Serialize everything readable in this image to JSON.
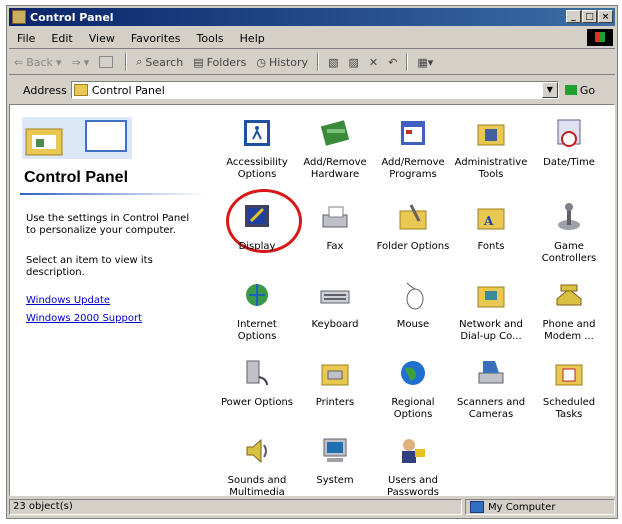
{
  "window": {
    "title": "Control Panel"
  },
  "menu": [
    "File",
    "Edit",
    "View",
    "Favorites",
    "Tools",
    "Help"
  ],
  "toolbar": {
    "back": "Back",
    "search": "Search",
    "folders": "Folders",
    "history": "History"
  },
  "address": {
    "label": "Address",
    "value": "Control Panel",
    "go": "Go"
  },
  "left": {
    "title": "Control Panel",
    "description": "Use the settings in Control Panel to personalize your computer.",
    "select_hint": "Select an item to view its description.",
    "links": [
      "Windows Update",
      "Windows 2000 Support"
    ]
  },
  "items": [
    {
      "label": "Accessibility Options",
      "icon": "accessibility-icon"
    },
    {
      "label": "Add/Remove Hardware",
      "icon": "hardware-icon"
    },
    {
      "label": "Add/Remove Programs",
      "icon": "programs-icon"
    },
    {
      "label": "Administrative Tools",
      "icon": "admin-tools-icon"
    },
    {
      "label": "Date/Time",
      "icon": "clock-icon"
    },
    {
      "label": "Display",
      "icon": "display-icon"
    },
    {
      "label": "Fax",
      "icon": "fax-icon"
    },
    {
      "label": "Folder Options",
      "icon": "folder-options-icon"
    },
    {
      "label": "Fonts",
      "icon": "fonts-icon"
    },
    {
      "label": "Game Controllers",
      "icon": "joystick-icon"
    },
    {
      "label": "Internet Options",
      "icon": "internet-icon"
    },
    {
      "label": "Keyboard",
      "icon": "keyboard-icon"
    },
    {
      "label": "Mouse",
      "icon": "mouse-icon"
    },
    {
      "label": "Network and Dial-up Co...",
      "icon": "network-icon"
    },
    {
      "label": "Phone and Modem ...",
      "icon": "phone-icon"
    },
    {
      "label": "Power Options",
      "icon": "power-icon"
    },
    {
      "label": "Printers",
      "icon": "printer-icon"
    },
    {
      "label": "Regional Options",
      "icon": "globe-icon"
    },
    {
      "label": "Scanners and Cameras",
      "icon": "scanner-icon"
    },
    {
      "label": "Scheduled Tasks",
      "icon": "calendar-icon"
    },
    {
      "label": "Sounds and Multimedia",
      "icon": "speaker-icon"
    },
    {
      "label": "System",
      "icon": "computer-icon"
    },
    {
      "label": "Users and Passwords",
      "icon": "users-icon"
    }
  ],
  "status": {
    "count": "23 object(s)",
    "zone": "My Computer"
  }
}
